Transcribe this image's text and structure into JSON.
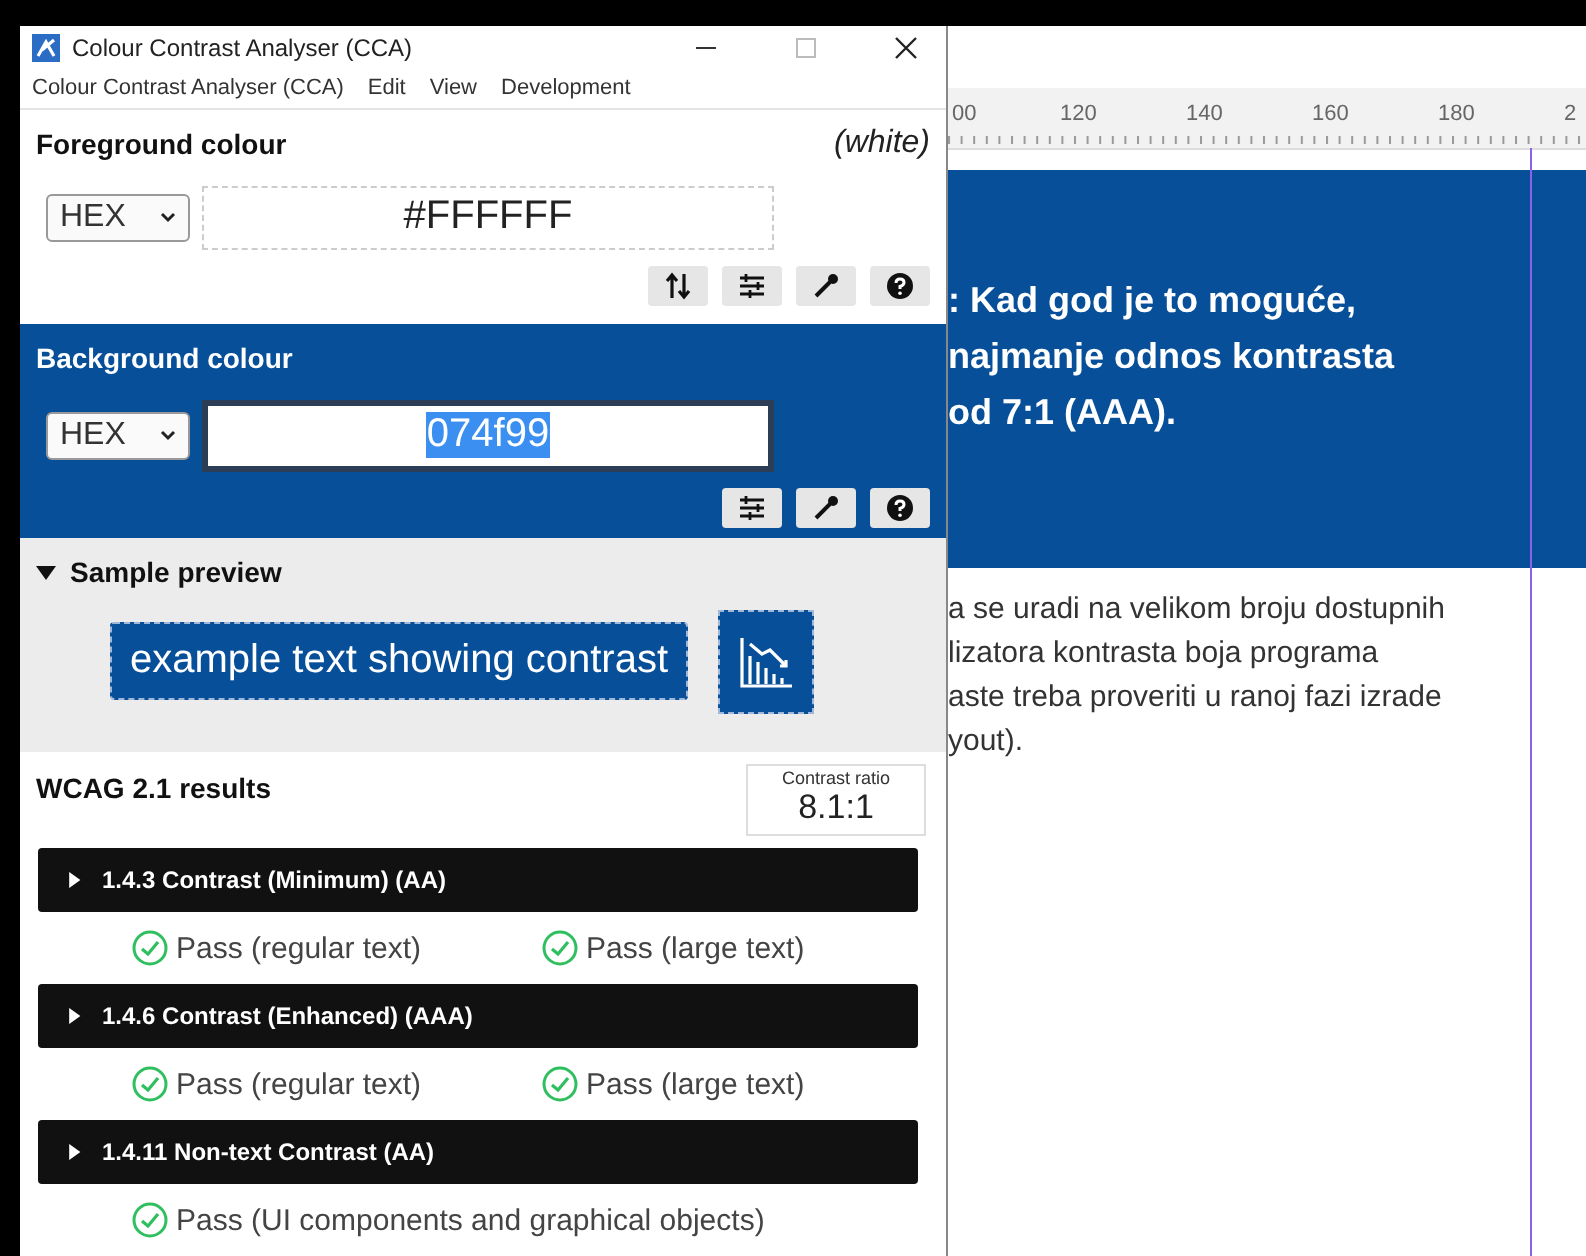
{
  "window": {
    "title": "Colour Contrast Analyser (CCA)"
  },
  "menu": [
    "Colour Contrast Analyser (CCA)",
    "Edit",
    "View",
    "Development"
  ],
  "foreground": {
    "title": "Foreground colour",
    "name": "(white)",
    "format": "HEX",
    "value": "#FFFFFF",
    "value_selected": false
  },
  "background": {
    "title": "Background colour",
    "format": "HEX",
    "value": "074f99",
    "value_selected": true
  },
  "sample_preview": {
    "title": "Sample preview",
    "expanded": true,
    "sample_text": "example text showing contrast"
  },
  "results": {
    "title": "WCAG 2.1 results",
    "ratio_label": "Contrast ratio",
    "ratio": "8.1:1",
    "sections": [
      {
        "title": "1.4.3 Contrast (Minimum) (AA)",
        "expanded": false,
        "checks": [
          {
            "label": "Pass (regular text)",
            "passed": true
          },
          {
            "label": "Pass (large text)",
            "passed": true
          }
        ]
      },
      {
        "title": "1.4.6 Contrast (Enhanced) (AAA)",
        "expanded": false,
        "checks": [
          {
            "label": "Pass (regular text)",
            "passed": true
          },
          {
            "label": "Pass (large text)",
            "passed": true
          }
        ]
      },
      {
        "title": "1.4.11 Non-text Contrast (AA)",
        "expanded": false,
        "checks": [
          {
            "label": "Pass (UI components and graphical objects)",
            "passed": true
          }
        ]
      }
    ]
  },
  "editor": {
    "ruler": [
      "00",
      "120",
      "140",
      "160",
      "180",
      "2"
    ],
    "headline": [
      ": Kad god je to moguće,",
      "najmanje odnos kontrasta",
      "od 7:1 (AAA)."
    ],
    "body": [
      "a se uradi na velikom broju dostupnih",
      "lizatora kontrasta boja programa",
      "aste treba proveriti u ranoj fazi izrade",
      "yout)."
    ]
  }
}
